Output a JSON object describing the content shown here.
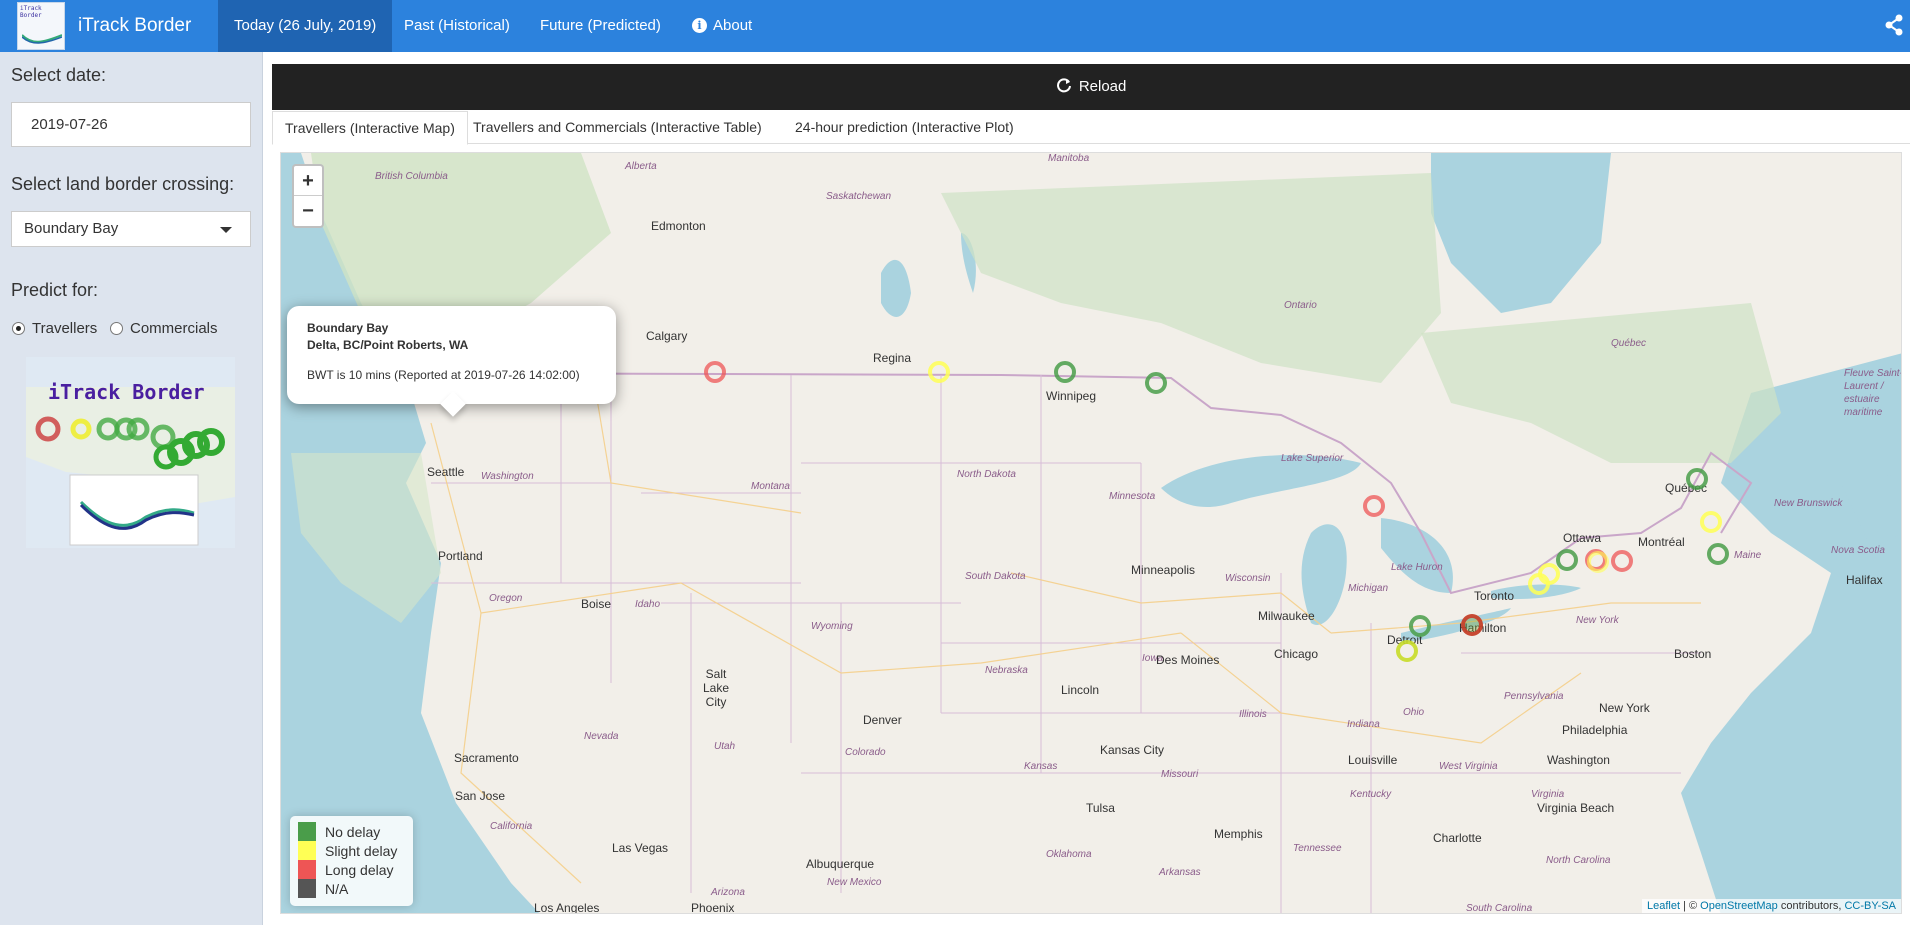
{
  "nav": {
    "brand_logo_text": "iTrack Border",
    "brand": "iTrack Border",
    "tabs": [
      "Today (26 July, 2019)",
      "Past (Historical)",
      "Future (Predicted)",
      "About"
    ],
    "active_tab": 0,
    "about_icon": "info-circle-icon",
    "share_icon": "share-icon"
  },
  "sidebar": {
    "date_label": "Select date:",
    "date_value": "2019-07-26",
    "crossing_label": "Select land border crossing:",
    "crossing_value": "Boundary Bay",
    "predict_label": "Predict for:",
    "radio_travellers": "Travellers",
    "radio_commercials": "Commercials",
    "selected_radio": "Travellers",
    "logo_title": "iTrack Border"
  },
  "main": {
    "reload_label": "Reload",
    "tabs": [
      "Travellers (Interactive Map)",
      "Travellers and Commercials (Interactive Table)",
      "24-hour prediction (Interactive Plot)"
    ],
    "active_tab": 0
  },
  "map": {
    "zoom_in": "+",
    "zoom_out": "−",
    "popup": {
      "title": "Boundary Bay",
      "subtitle": "Delta, BC/Point Roberts, WA",
      "body": "BWT is 10 mins (Reported at 2019-07-26 14:02:00)"
    },
    "legend": [
      {
        "label": "No delay",
        "color": "#4a9d4a"
      },
      {
        "label": "Slight delay",
        "color": "#ffff55"
      },
      {
        "label": "Long delay",
        "color": "#ee5555"
      },
      {
        "label": "N/A",
        "color": "#555555"
      }
    ],
    "attribution": {
      "leaflet": "Leaflet",
      "sep": " | © ",
      "osm": "OpenStreetMap",
      "contrib": " contributors, ",
      "license": "CC-BY-SA"
    },
    "cities": [
      "Edmonton",
      "Calgary",
      "Regina",
      "Winnipeg",
      "Seattle",
      "Portland",
      "Boise",
      "Salt Lake City",
      "Denver",
      "Sacramento",
      "San Jose",
      "Las Vegas",
      "Los Angeles",
      "Phoenix",
      "Albuquerque",
      "Minneapolis",
      "Milwaukee",
      "Chicago",
      "Detroit",
      "Toronto",
      "Hamilton",
      "Ottawa",
      "Montréal",
      "Québec",
      "Halifax",
      "Boston",
      "New York",
      "Philadelphia",
      "Washington",
      "Virginia Beach",
      "Charlotte",
      "Memphis",
      "Tulsa",
      "Kansas City",
      "Lincoln",
      "Des Moines",
      "Louisville"
    ],
    "regions": [
      "Alberta",
      "British Columbia",
      "Saskatchewan",
      "Manitoba",
      "Ontario",
      "Québec",
      "Washington",
      "Oregon",
      "Idaho",
      "Montana",
      "Wyoming",
      "Nevada",
      "Utah",
      "California",
      "Arizona",
      "Colorado",
      "New Mexico",
      "North Dakota",
      "South Dakota",
      "Nebraska",
      "Kansas",
      "Oklahoma",
      "Minnesota",
      "Iowa",
      "Missouri",
      "Wisconsin",
      "Illinois",
      "Michigan",
      "Indiana",
      "Ohio",
      "Kentucky",
      "Tennessee",
      "Arkansas",
      "Pennsylvania",
      "New York",
      "West Virginia",
      "Virginia",
      "North Carolina",
      "South Carolina",
      "Maine",
      "New Brunswick",
      "Nova Scotia",
      "Lake Superior",
      "Lake Huron",
      "Fleuve Saint-Laurent / estuaire maritime"
    ],
    "markers_status": [
      "no-delay",
      "no-delay",
      "na",
      "long-delay",
      "slight-delay",
      "no-delay",
      "no-delay",
      "long-delay",
      "no-delay",
      "slight-delay",
      "slight-delay",
      "slight-delay",
      "no-delay",
      "long-delay",
      "slight-delay",
      "long-delay",
      "long-delay",
      "no-delay",
      "slight-delay",
      "no-delay"
    ]
  }
}
